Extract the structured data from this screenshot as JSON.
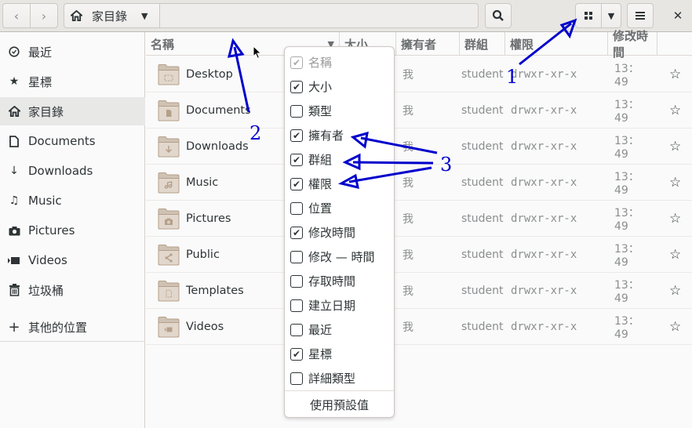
{
  "headerbar": {
    "back_icon": "‹",
    "forward_icon": "›",
    "path_label": "家目錄",
    "path_dropdown_icon": "▼",
    "search_icon": "search-icon",
    "view_dropdown_icon": "▼",
    "menu_icon": "≡",
    "close_icon": "✕"
  },
  "sidebar": {
    "items": [
      {
        "label": "最近",
        "icon": "◷"
      },
      {
        "label": "星標",
        "icon": "★"
      },
      {
        "label": "家目錄",
        "icon": "⌂"
      },
      {
        "label": "Documents",
        "icon": "🗋"
      },
      {
        "label": "Downloads",
        "icon": "↓"
      },
      {
        "label": "Music",
        "icon": "♫"
      },
      {
        "label": "Pictures",
        "icon": "◙"
      },
      {
        "label": "Videos",
        "icon": "▶"
      },
      {
        "label": "垃圾桶",
        "icon": "🗑"
      }
    ],
    "other_locations": {
      "label": "其他的位置",
      "icon": "+"
    }
  },
  "columns": {
    "name": "名稱",
    "size": "大小",
    "owner": "擁有者",
    "group": "群組",
    "permissions": "權限",
    "modified": "修改時間"
  },
  "files": [
    {
      "name": "Desktop",
      "owner": "我",
      "group": "student",
      "permissions": "drwxr-xr-x",
      "modified": "13：49",
      "star": "☆"
    },
    {
      "name": "Documents",
      "owner": "我",
      "group": "student",
      "permissions": "drwxr-xr-x",
      "modified": "13：49",
      "star": "☆"
    },
    {
      "name": "Downloads",
      "owner": "我",
      "group": "student",
      "permissions": "drwxr-xr-x",
      "modified": "13：49",
      "star": "☆"
    },
    {
      "name": "Music",
      "owner": "我",
      "group": "student",
      "permissions": "drwxr-xr-x",
      "modified": "13：49",
      "star": "☆"
    },
    {
      "name": "Pictures",
      "owner": "我",
      "group": "student",
      "permissions": "drwxr-xr-x",
      "modified": "13：49",
      "star": "☆"
    },
    {
      "name": "Public",
      "owner": "我",
      "group": "student",
      "permissions": "drwxr-xr-x",
      "modified": "13：49",
      "star": "☆"
    },
    {
      "name": "Templates",
      "owner": "我",
      "group": "student",
      "permissions": "drwxr-xr-x",
      "modified": "13：49",
      "star": "☆"
    },
    {
      "name": "Videos",
      "owner": "我",
      "group": "student",
      "permissions": "drwxr-xr-x",
      "modified": "13：49",
      "star": "☆"
    }
  ],
  "column_popover": {
    "items": [
      {
        "label": "名稱",
        "checked": true,
        "disabled": true
      },
      {
        "label": "大小",
        "checked": true
      },
      {
        "label": "類型",
        "checked": false
      },
      {
        "label": "擁有者",
        "checked": true
      },
      {
        "label": "群組",
        "checked": true
      },
      {
        "label": "權限",
        "checked": true
      },
      {
        "label": "位置",
        "checked": false
      },
      {
        "label": "修改時間",
        "checked": true
      },
      {
        "label": "修改 — 時間",
        "checked": false
      },
      {
        "label": "存取時間",
        "checked": false
      },
      {
        "label": "建立日期",
        "checked": false
      },
      {
        "label": "最近",
        "checked": false
      },
      {
        "label": "星標",
        "checked": true
      },
      {
        "label": "詳細類型",
        "checked": false
      }
    ],
    "reset_label": "使用預設值"
  },
  "annotations": {
    "label_1": "1",
    "label_2": "2",
    "label_3": "3",
    "color": "#0000cc"
  }
}
